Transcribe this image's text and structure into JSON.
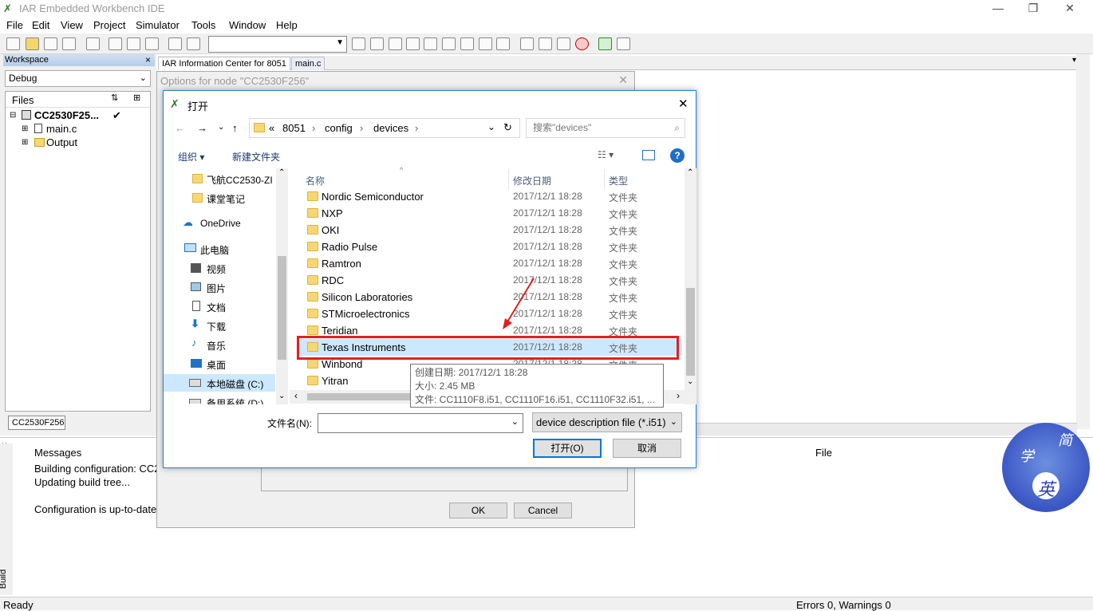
{
  "app": {
    "title": "IAR Embedded Workbench IDE",
    "minimize": "—",
    "restore": "❐",
    "close": "✕"
  },
  "menu": [
    "File",
    "Edit",
    "View",
    "Project",
    "Simulator",
    "Tools",
    "Window",
    "Help"
  ],
  "workspace": {
    "header": "Workspace",
    "close": "×",
    "config": "Debug",
    "files_label": "Files",
    "project": "CC2530F25...",
    "check": "✔",
    "items": [
      "main.c",
      "Output"
    ],
    "tab": "CC2530F256"
  },
  "editor_tabs": [
    "IAR Information Center for 8051",
    "main.c"
  ],
  "messages": {
    "build_label": "Build",
    "header": "Messages",
    "file_header": "File",
    "lines": [
      "Building configuration: CC2",
      "Updating build tree...",
      "",
      "Configuration is up-to-date"
    ]
  },
  "status": {
    "left": "Ready",
    "right": "Errors 0, Warnings 0"
  },
  "options_dialog": {
    "title": "Options for node \"CC2530F256\"",
    "ok": "OK",
    "cancel": "Cancel"
  },
  "open_dialog": {
    "title": "打开",
    "breadcrumb": [
      "«",
      "8051",
      "›",
      "config",
      "›",
      "devices",
      "›"
    ],
    "search_placeholder": "搜索\"devices\"",
    "organize": "组织 ▾",
    "new_folder": "新建文件夹",
    "nav_items": [
      {
        "label": "飞航CC2530-ZI",
        "icon": "folder-icon"
      },
      {
        "label": "课堂笔记",
        "icon": "folder-icon"
      },
      {
        "label": "OneDrive",
        "icon": "cloud-icon"
      },
      {
        "label": "此电脑",
        "icon": "computer-icon"
      },
      {
        "label": "视频",
        "icon": "video-icon"
      },
      {
        "label": "图片",
        "icon": "picture-icon"
      },
      {
        "label": "文档",
        "icon": "document-icon"
      },
      {
        "label": "下载",
        "icon": "download-icon"
      },
      {
        "label": "音乐",
        "icon": "music-icon"
      },
      {
        "label": "桌面",
        "icon": "desktop-icon"
      },
      {
        "label": "本地磁盘 (C:)",
        "icon": "drive-icon"
      },
      {
        "label": "备用系统 (D:)",
        "icon": "drive-icon"
      }
    ],
    "columns": {
      "name": "名称",
      "date": "修改日期",
      "type": "类型"
    },
    "rows": [
      {
        "name": "Nordic Semiconductor",
        "date": "2017/12/1 18:28",
        "type": "文件夹"
      },
      {
        "name": "NXP",
        "date": "2017/12/1 18:28",
        "type": "文件夹"
      },
      {
        "name": "OKI",
        "date": "2017/12/1 18:28",
        "type": "文件夹"
      },
      {
        "name": "Radio Pulse",
        "date": "2017/12/1 18:28",
        "type": "文件夹"
      },
      {
        "name": "Ramtron",
        "date": "2017/12/1 18:28",
        "type": "文件夹"
      },
      {
        "name": "RDC",
        "date": "2017/12/1 18:28",
        "type": "文件夹"
      },
      {
        "name": "Silicon Laboratories",
        "date": "2017/12/1 18:28",
        "type": "文件夹"
      },
      {
        "name": "STMicroelectronics",
        "date": "2017/12/1 18:28",
        "type": "文件夹"
      },
      {
        "name": "Teridian",
        "date": "2017/12/1 18:28",
        "type": "文件夹"
      },
      {
        "name": "Texas Instruments",
        "date": "2017/12/1 18:28",
        "type": "文件夹",
        "selected": true
      },
      {
        "name": "Winbond",
        "date": "2017/12/1 18:28",
        "type": "文件夹"
      },
      {
        "name": "Yitran",
        "date": "",
        "type": ""
      }
    ],
    "tooltip": [
      "创建日期: 2017/12/1 18:28",
      "大小: 2.45 MB",
      "文件: CC1110F8.i51, CC1110F16.i51, CC1110F32.i51, ..."
    ],
    "filename_label": "文件名(N):",
    "filetype": "device description file (*.i51)",
    "open": "打开(O)",
    "cancel": "取消"
  },
  "watermark": [
    "学",
    "简",
    "英"
  ],
  "colors": {
    "highlight": "#e02020",
    "selection": "#cce8ff",
    "accent": "#0078d7"
  }
}
